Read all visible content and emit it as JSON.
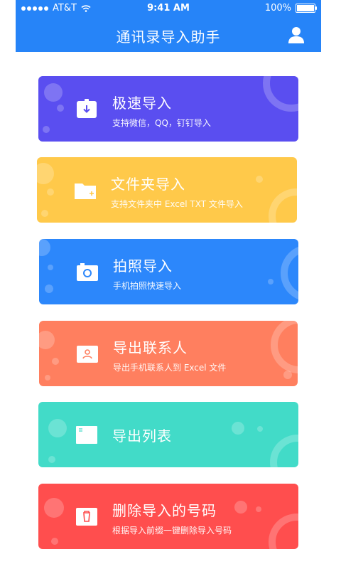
{
  "status_bar": {
    "carrier": "AT&T",
    "time": "9:41 AM",
    "battery": "100%"
  },
  "header": {
    "title": "通讯录导入助手",
    "profile_icon": "user-icon",
    "color": "#2684f8"
  },
  "cards": [
    {
      "title": "极速导入",
      "subtitle": "支持微信，QQ，钉钉导入",
      "color": "#5a4ef0",
      "icon": "download-icon"
    },
    {
      "title": "文件夹导入",
      "subtitle": "支持文件夹中 Excel TXT 文件导入",
      "color": "#ffc94a",
      "icon": "folder-icon"
    },
    {
      "title": "拍照导入",
      "subtitle": "手机拍照快速导入",
      "color": "#2c87fb",
      "icon": "camera-icon"
    },
    {
      "title": "导出联系人",
      "subtitle": "导出手机联系人到 Excel 文件",
      "color": "#ff7f5f",
      "icon": "contact-card-icon"
    },
    {
      "title": "导出列表",
      "color": "#42dbc8",
      "icon": "list-icon"
    },
    {
      "title": "删除导入的号码",
      "subtitle": "根据导入前缀一键删除导入号码",
      "color": "#ff4e4e",
      "icon": "trash-icon"
    }
  ]
}
